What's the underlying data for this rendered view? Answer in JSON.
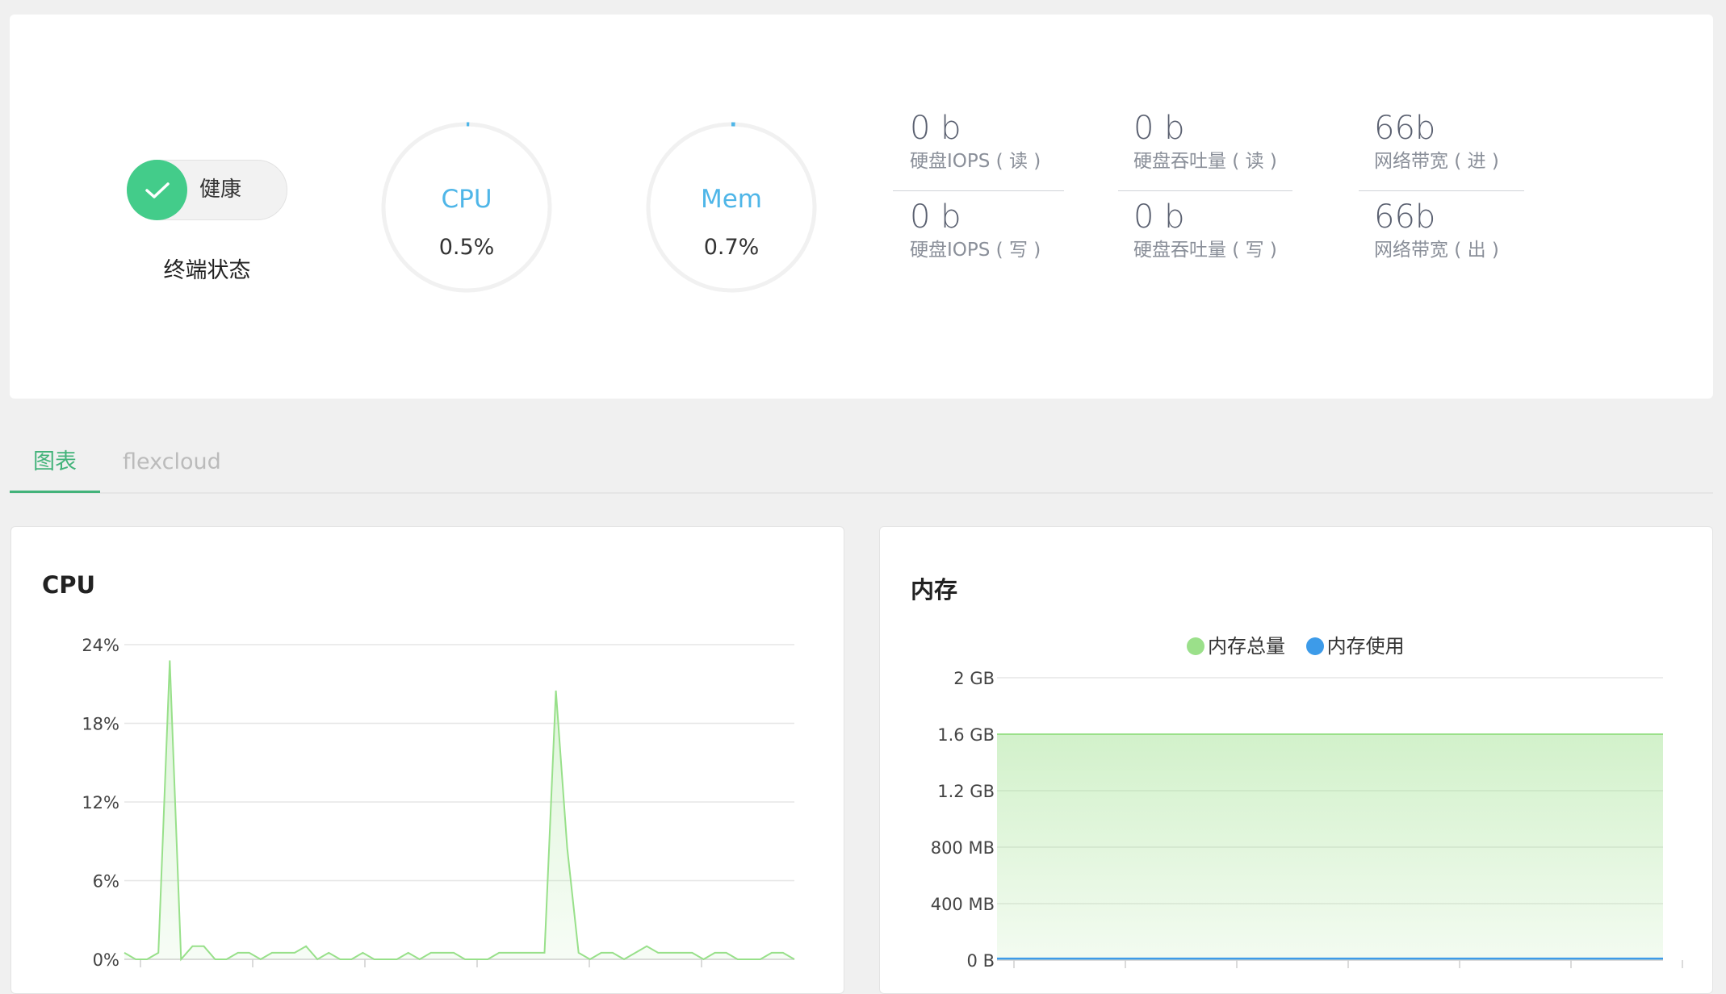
{
  "summary": {
    "health_label": "健康",
    "terminal_status_label": "终端状态",
    "gauges": [
      {
        "name": "CPU",
        "value": "0.5%",
        "fraction": 0.005
      },
      {
        "name": "Mem",
        "value": "0.7%",
        "fraction": 0.007
      }
    ],
    "metrics": [
      {
        "value": "0 b",
        "label": "硬盘IOPS ( 读 )"
      },
      {
        "value": "0 b",
        "label": "硬盘IOPS ( 写 )"
      },
      {
        "value": "0 b",
        "label": "硬盘吞吐量 ( 读 )"
      },
      {
        "value": "0 b",
        "label": "硬盘吞吐量 ( 写 )"
      },
      {
        "value": "66b",
        "label": "网络带宽 ( 进 )"
      },
      {
        "value": "66b",
        "label": "网络带宽 ( 出 )"
      }
    ]
  },
  "tabs": [
    {
      "label": "图表",
      "active": true
    },
    {
      "label": "flexcloud",
      "active": false
    }
  ],
  "colors": {
    "accent_green": "#43cc8a",
    "tab_green": "#43b37a",
    "gauge_blue": "#4fb6e8",
    "cpu_line": "#98e08a",
    "mem_total": "#9be08a",
    "mem_used": "#3d9be9"
  },
  "chart_data": [
    {
      "type": "area",
      "title": "CPU",
      "y_ticks": [
        "0%",
        "6%",
        "12%",
        "18%",
        "24%"
      ],
      "ylim": [
        0,
        24
      ],
      "grid": true,
      "values": [
        0.5,
        0,
        0,
        0.5,
        22.8,
        0,
        1,
        1,
        0,
        0,
        0.5,
        0.5,
        0,
        0.5,
        0.5,
        0.5,
        1,
        0,
        0.5,
        0,
        0,
        0.5,
        0,
        0,
        0,
        0.5,
        0,
        0.5,
        0.5,
        0.5,
        0,
        0,
        0,
        0.5,
        0.5,
        0.5,
        0.5,
        0.5,
        20.5,
        8.5,
        0.5,
        0,
        0.5,
        0.5,
        0,
        0.5,
        1,
        0.5,
        0.5,
        0.5,
        0.5,
        0,
        0.5,
        0.5,
        0,
        0,
        0,
        0.5,
        0.5,
        0
      ]
    },
    {
      "type": "area",
      "title": "内存",
      "legend_position": "top-center",
      "series": [
        {
          "name": "内存总量",
          "values": [
            1.6,
            1.6,
            1.6,
            1.6,
            1.6,
            1.6,
            1.6,
            1.6,
            1.6,
            1.6,
            1.6,
            1.6,
            1.6
          ]
        },
        {
          "name": "内存使用",
          "values": [
            0.011,
            0.011,
            0.011,
            0.011,
            0.011,
            0.011,
            0.011,
            0.011,
            0.011,
            0.011,
            0.011,
            0.011,
            0.011
          ]
        }
      ],
      "y_ticks": [
        "0 B",
        "400 MB",
        "800 MB",
        "1.2 GB",
        "1.6 GB",
        "2 GB"
      ],
      "ylim": [
        0,
        2
      ],
      "grid": true
    }
  ]
}
